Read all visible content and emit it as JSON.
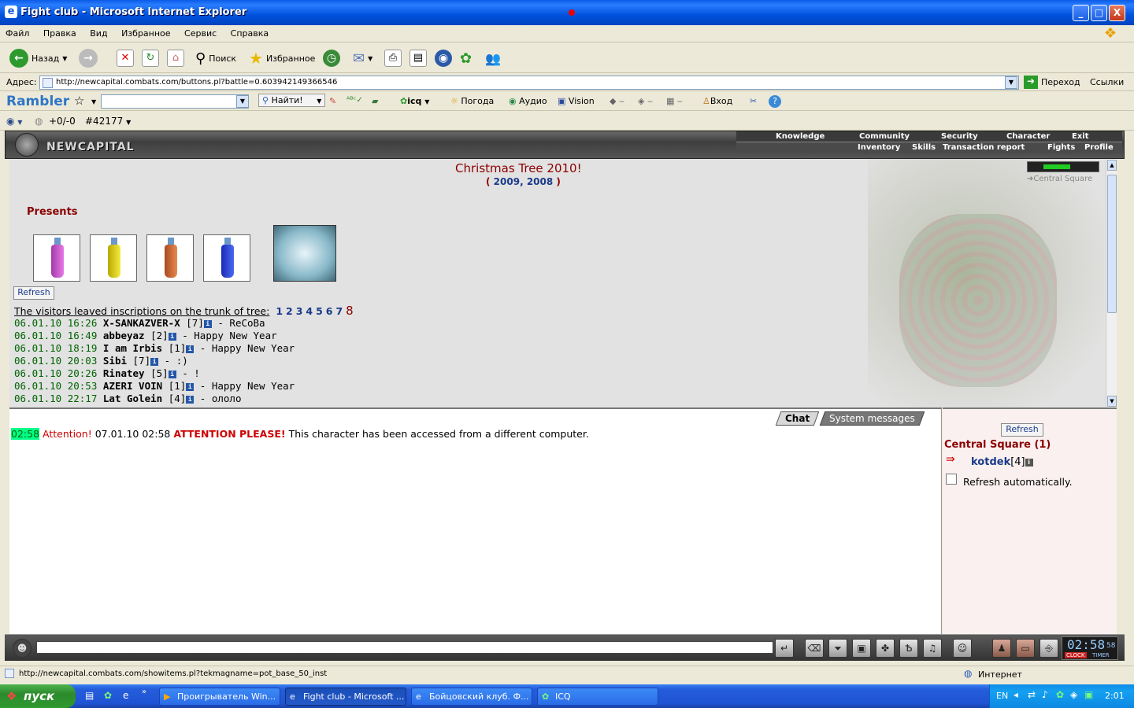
{
  "window": {
    "title": "Fight club - Microsoft Internet Explorer",
    "min": "_",
    "max": "□",
    "close": "X"
  },
  "menu": [
    "Файл",
    "Правка",
    "Вид",
    "Избранное",
    "Сервис",
    "Справка"
  ],
  "toolbar": {
    "back": "Назад",
    "search": "Поиск",
    "favorites": "Избранное"
  },
  "address": {
    "label": "Адрес:",
    "url": "http://newcapital.combats.com/buttons.pl?battle=0.603942149366546",
    "go": "Переход",
    "links": "Ссылки"
  },
  "rambler": {
    "logo": "Rambler",
    "find": "Найти!",
    "icq": "icq",
    "weather": "Погода",
    "audio": "Аудио",
    "vision": "Vision",
    "login": "Вход"
  },
  "linkbar": {
    "score": "+0/-0",
    "id": "#42177"
  },
  "game": {
    "logo": "NEWCAPITAL",
    "nav_top": [
      "Knowledge",
      "Community",
      "Security",
      "Character",
      "Exit"
    ],
    "nav_bottom": [
      "Inventory",
      "Skills",
      "Transaction report",
      "Fights",
      "Profile"
    ],
    "location_link": "Central Square",
    "title": "Christmas Tree 2010!",
    "prev_years": {
      "open": "(",
      "y1": "2009",
      "sep": ",",
      "y2": "2008",
      "close": ")"
    },
    "presents_label": "Presents",
    "refresh_button": "Refresh",
    "inscriptions_label": "The visitors leaved inscriptions on the trunk of tree:",
    "pages": [
      "1",
      "2",
      "3",
      "4",
      "5",
      "6",
      "7"
    ],
    "current_page": "8",
    "inscriptions": [
      {
        "date": "06.01.10 16:26",
        "name": "X-SANKAZVER-X",
        "level": "[7]",
        "text": "- ReCoBa"
      },
      {
        "date": "06.01.10 16:49",
        "name": "abbeyaz",
        "level": "[2]",
        "text": "- Happy New Year"
      },
      {
        "date": "06.01.10 18:19",
        "name": "I am Irbis",
        "level": "[1]",
        "text": "- Happy New Year"
      },
      {
        "date": "06.01.10 20:03",
        "name": "Sibi",
        "level": "[7]",
        "text": "- :)"
      },
      {
        "date": "06.01.10 20:26",
        "name": "Rinatey",
        "level": "[5]",
        "text": "- !"
      },
      {
        "date": "06.01.10 20:53",
        "name": "AZERI VOIN",
        "level": "[1]",
        "text": "- Happy New Year"
      },
      {
        "date": "06.01.10 22:17",
        "name": "Lat Golein",
        "level": "[4]",
        "text": "- ололо"
      }
    ],
    "chat_tabs": [
      "Chat",
      "System messages"
    ],
    "chat_message": {
      "time": "02:58",
      "attention": "Attention!",
      "stamp": "07.01.10 02:58",
      "please": "ATTENTION PLEASE!",
      "text": "This character has been accessed from a different computer."
    },
    "side": {
      "refresh": "Refresh",
      "location": "Central Square (1)",
      "user": "kotdek",
      "user_level": "[4]",
      "auto_refresh": "Refresh automatically."
    },
    "clock": {
      "time": "02:58",
      "sec": "58",
      "clock_label": "CLOCK",
      "timer_label": "TIMER"
    }
  },
  "status": {
    "url": "http://newcapital.combats.com/showitems.pl?tekmagname=pot_base_50_inst",
    "zone": "Интернет"
  },
  "taskbar": {
    "start": "пуск",
    "tasks": [
      "Проигрыватель Win...",
      "Fight club - Microsoft ...",
      "Бойцовский клуб. Ф...",
      "ICQ"
    ],
    "lang": "EN",
    "time": "2:01"
  },
  "colors": {
    "accent_red": "#8b0000",
    "date_green": "#006400",
    "link_blue": "#1a3a8a"
  }
}
